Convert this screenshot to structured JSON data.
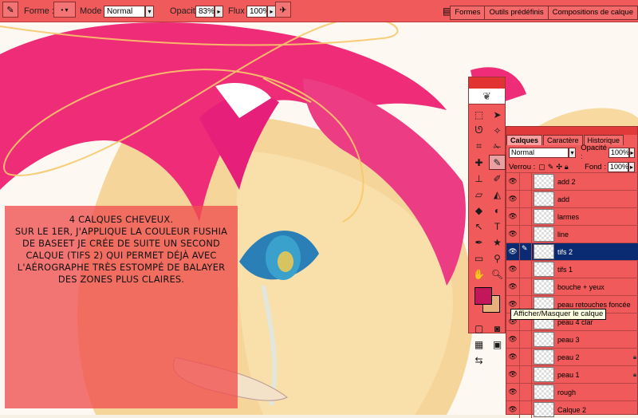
{
  "options_bar": {
    "forme_label": "Forme :",
    "mode_label": "Mode :",
    "mode_value": "Normal",
    "opacite_label": "Opacité :",
    "opacite_value": "83%",
    "flux_label": "Flux :",
    "flux_value": "100%",
    "tabs": [
      "Formes",
      "Outils prédéfinis",
      "Compositions de calque"
    ]
  },
  "layers_panel": {
    "tabs": [
      "Calques",
      "Caractère",
      "Historique"
    ],
    "blend_mode": "Normal",
    "opacity_label": "Opacité :",
    "opacity_value": "100%",
    "lock_label": "Verrou :",
    "fill_label": "Fond :",
    "fill_value": "100%",
    "layers": [
      {
        "name": "add 2",
        "selected": false
      },
      {
        "name": "add",
        "selected": false
      },
      {
        "name": "larmes",
        "selected": false
      },
      {
        "name": "line",
        "selected": false
      },
      {
        "name": "tifs 2",
        "selected": true
      },
      {
        "name": "tifs 1",
        "selected": false
      },
      {
        "name": "bouche + yeux",
        "selected": false
      },
      {
        "name": "peau retouches foncée (...",
        "selected": false
      },
      {
        "name": "peau 4  clar",
        "selected": false
      },
      {
        "name": "peau 3",
        "selected": false
      },
      {
        "name": "peau 2",
        "selected": false
      },
      {
        "name": "peau 1",
        "selected": false
      },
      {
        "name": "rough",
        "selected": false
      },
      {
        "name": "Calque 2",
        "selected": false
      }
    ],
    "tooltip": "Afficher/Masquer le calque"
  },
  "colors": {
    "foreground": "#c2185b",
    "background": "#e8b07a",
    "accent": "#f05a5a",
    "hair": "#ef2f7a",
    "skin": "#f6d79a"
  },
  "annotation": {
    "lines": [
      "4 CALQUES CHEVEUX.",
      "SUR LE 1ER, J'APPLIQUE LA COULEUR FUSHIA",
      "DE BASEET JE CRÉE DE SUITE UN SECOND",
      "CALQUE (TIFS 2) QUI PERMET DÉJÀ AVEC",
      "L'AÉROGRAPHE TRÈS ESTOMPÉ DE  BALAYER",
      "DES ZONES PLUS CLAIRES."
    ]
  }
}
